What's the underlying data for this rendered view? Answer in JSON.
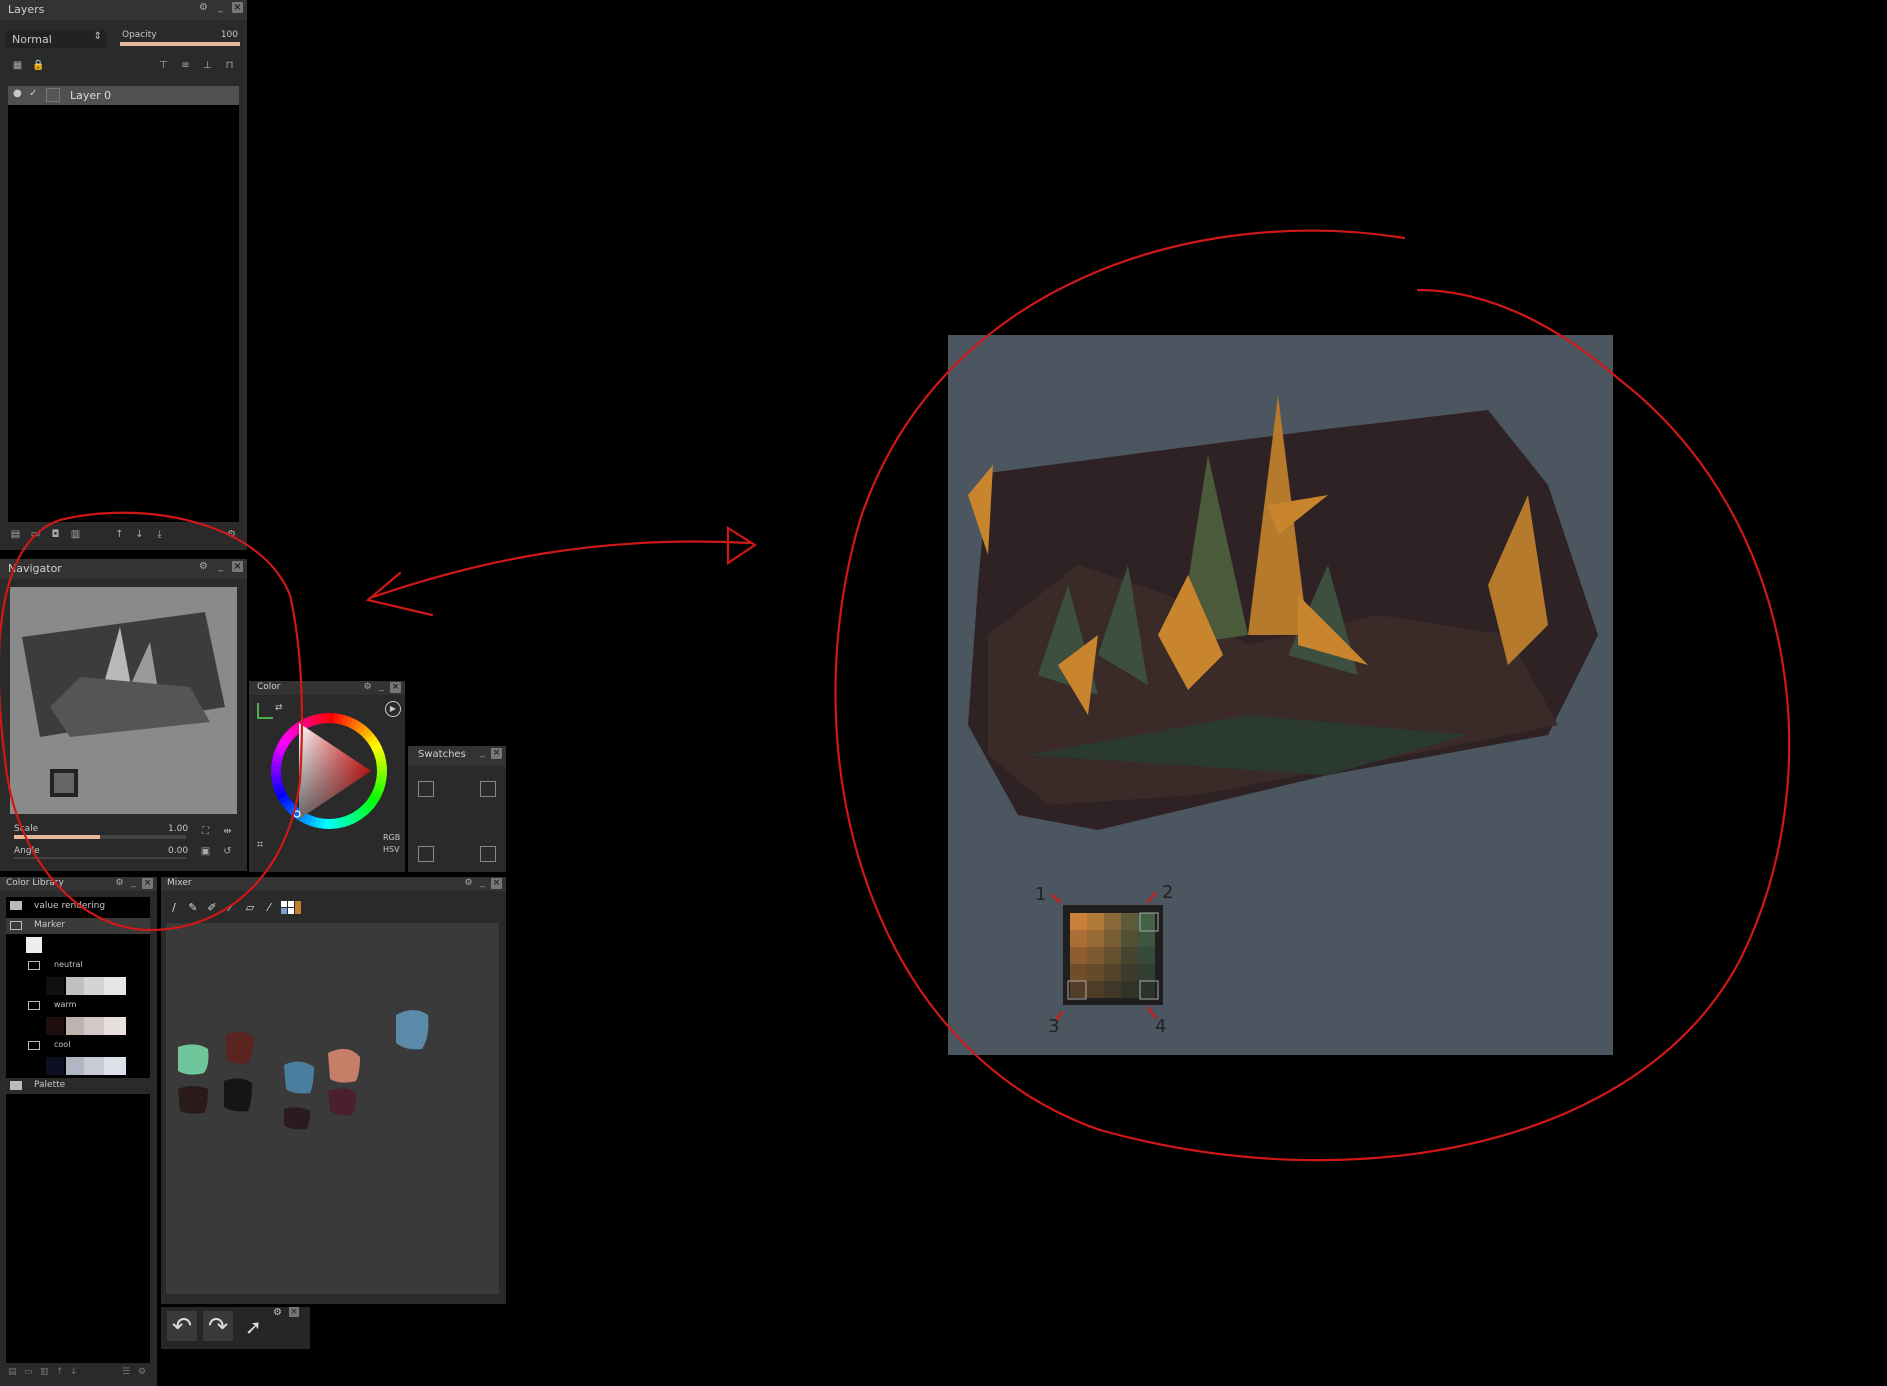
{
  "layers_panel": {
    "title": "Layers",
    "blend_mode": "Normal",
    "opacity_label": "Opacity",
    "opacity_value": "100",
    "opacity_fraction": 1.0,
    "layer_name": "Layer 0"
  },
  "navigator_panel": {
    "title": "Navigator",
    "scale_label": "Scale",
    "scale_value": "1.00",
    "scale_fraction": 0.5,
    "angle_label": "Angle",
    "angle_value": "0.00"
  },
  "color_panel": {
    "title": "Color",
    "rgb_label": "RGB",
    "hsv_label": "HSV"
  },
  "swatches_panel": {
    "title": "Swatches"
  },
  "color_library_panel": {
    "title": "Color Library",
    "items": [
      {
        "label": "value rendering"
      },
      {
        "label": "Marker"
      },
      {
        "label": "neutral"
      },
      {
        "label": "warm"
      },
      {
        "label": "cool"
      },
      {
        "label": "Palette"
      }
    ]
  },
  "mixer_panel": {
    "title": "Mixer"
  },
  "annotations": {
    "label_1": "1",
    "label_2": "2",
    "label_3": "3",
    "label_4": "4"
  },
  "colors": {
    "annotation_red": "#d01818",
    "canvas_bg": "#4b5660",
    "orange": "#c8852e",
    "dark_brown": "#2e2224",
    "green": "#3d5040",
    "panel_bg": "#2a2a2a",
    "accent_peach": "#e7b79a"
  },
  "icons": [
    "gear-icon",
    "minimize-icon",
    "close-icon",
    "eye-icon",
    "lock-icon",
    "undo-icon",
    "redo-icon",
    "transform-icon",
    "brush-icon",
    "eyedropper-icon",
    "folder-icon",
    "play-icon"
  ]
}
